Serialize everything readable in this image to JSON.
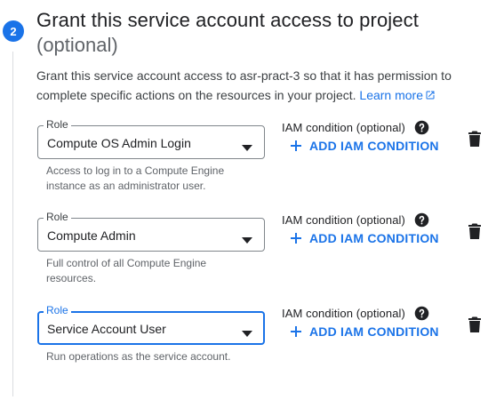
{
  "step": {
    "number": "2",
    "title": "Grant this service account access to project",
    "optional_label": "(optional)",
    "description": "Grant this service account access to asr-pract-3 so that it has permission to complete specific actions on the resources in your project.",
    "learn_more_label": "Learn more"
  },
  "roles": [
    {
      "field_label": "Role",
      "value": "Compute OS Admin Login",
      "helper": "Access to log in to a Compute Engine instance as an administrator user.",
      "iam_condition_label": "IAM condition (optional)",
      "add_iam_label": "ADD IAM CONDITION",
      "focused": false
    },
    {
      "field_label": "Role",
      "value": "Compute Admin",
      "helper": "Full control of all Compute Engine resources.",
      "iam_condition_label": "IAM condition (optional)",
      "add_iam_label": "ADD IAM CONDITION",
      "focused": false
    },
    {
      "field_label": "Role",
      "value": "Service Account User",
      "helper": "Run operations as the service account.",
      "iam_condition_label": "IAM condition (optional)",
      "add_iam_label": "ADD IAM CONDITION",
      "focused": true
    }
  ],
  "icons": {
    "step_badge": "step-number-badge",
    "external_link": "open-in-new-icon",
    "dropdown": "arrow-drop-down-icon",
    "help": "help-circle-icon",
    "add": "plus-icon",
    "delete": "trash-icon"
  },
  "colors": {
    "accent": "#1a73e8",
    "text_primary": "#202124",
    "text_secondary": "#5f6368",
    "border": "#80868b"
  }
}
